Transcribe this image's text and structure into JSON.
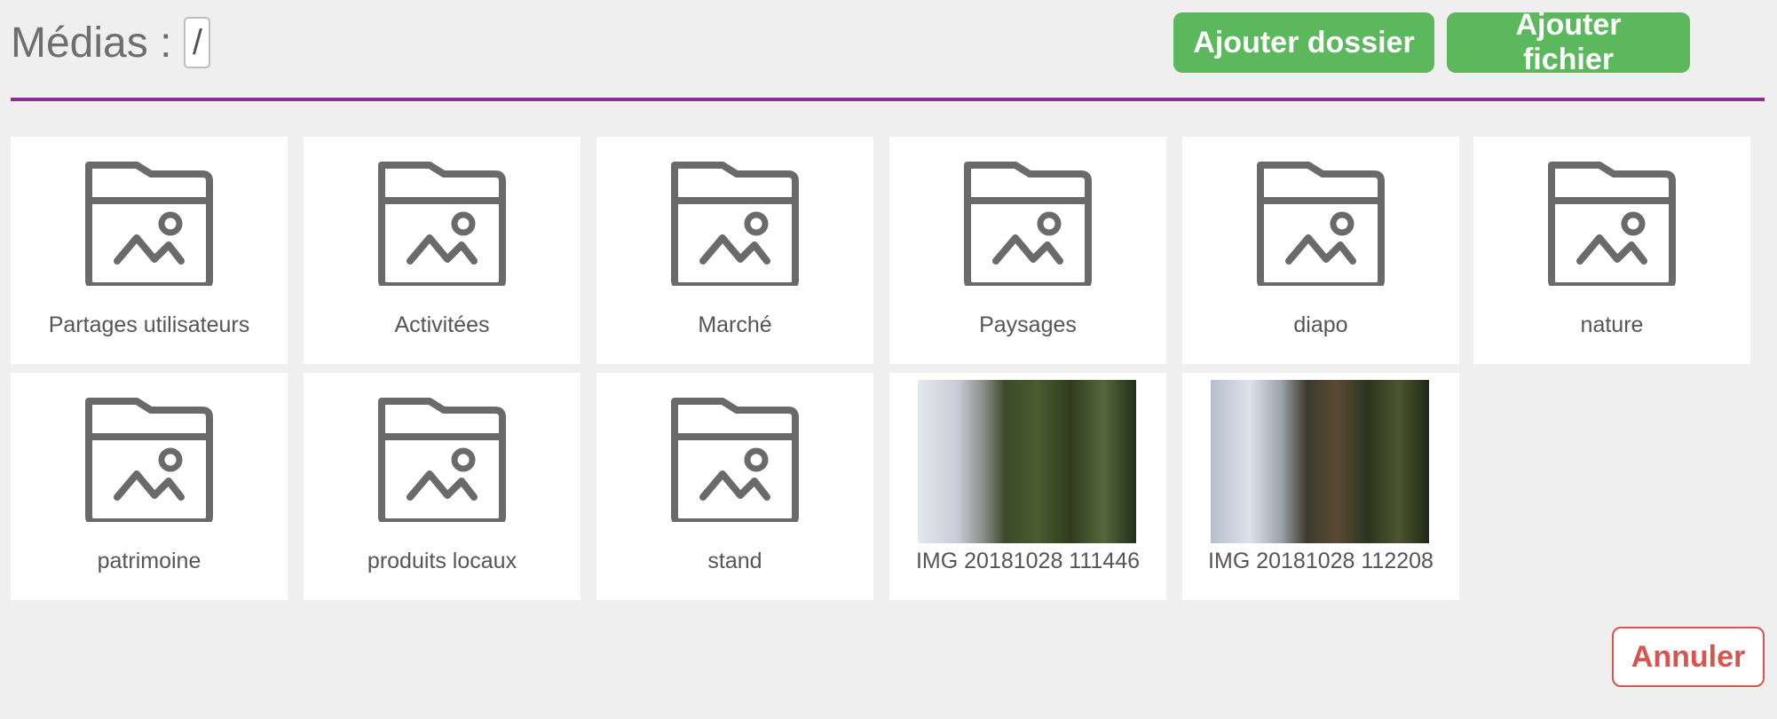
{
  "header": {
    "title": "Médias :",
    "path": "/",
    "add_folder_label": "Ajouter dossier",
    "add_file_label": "Ajouter fichier",
    "divider_color": "#8d2c91",
    "button_color": "#5cb85c"
  },
  "items": [
    {
      "type": "folder",
      "name": "Partages utilisateurs",
      "icon": "folder-image-icon"
    },
    {
      "type": "folder",
      "name": "Activitées",
      "icon": "folder-image-icon"
    },
    {
      "type": "folder",
      "name": "Marché",
      "icon": "folder-image-icon"
    },
    {
      "type": "folder",
      "name": "Paysages",
      "icon": "folder-image-icon"
    },
    {
      "type": "folder",
      "name": "diapo",
      "icon": "folder-image-icon"
    },
    {
      "type": "folder",
      "name": "nature",
      "icon": "folder-image-icon"
    },
    {
      "type": "folder",
      "name": "patrimoine",
      "icon": "folder-image-icon"
    },
    {
      "type": "folder",
      "name": "produits locaux",
      "icon": "folder-image-icon"
    },
    {
      "type": "folder",
      "name": "stand",
      "icon": "folder-image-icon"
    },
    {
      "type": "image",
      "name": "IMG 20181028 111446",
      "icon": "photo-thumbnail"
    },
    {
      "type": "image",
      "name": "IMG 20181028 112208",
      "icon": "photo-thumbnail"
    }
  ],
  "footer": {
    "cancel_label": "Annuler",
    "cancel_color": "#d9534f"
  }
}
